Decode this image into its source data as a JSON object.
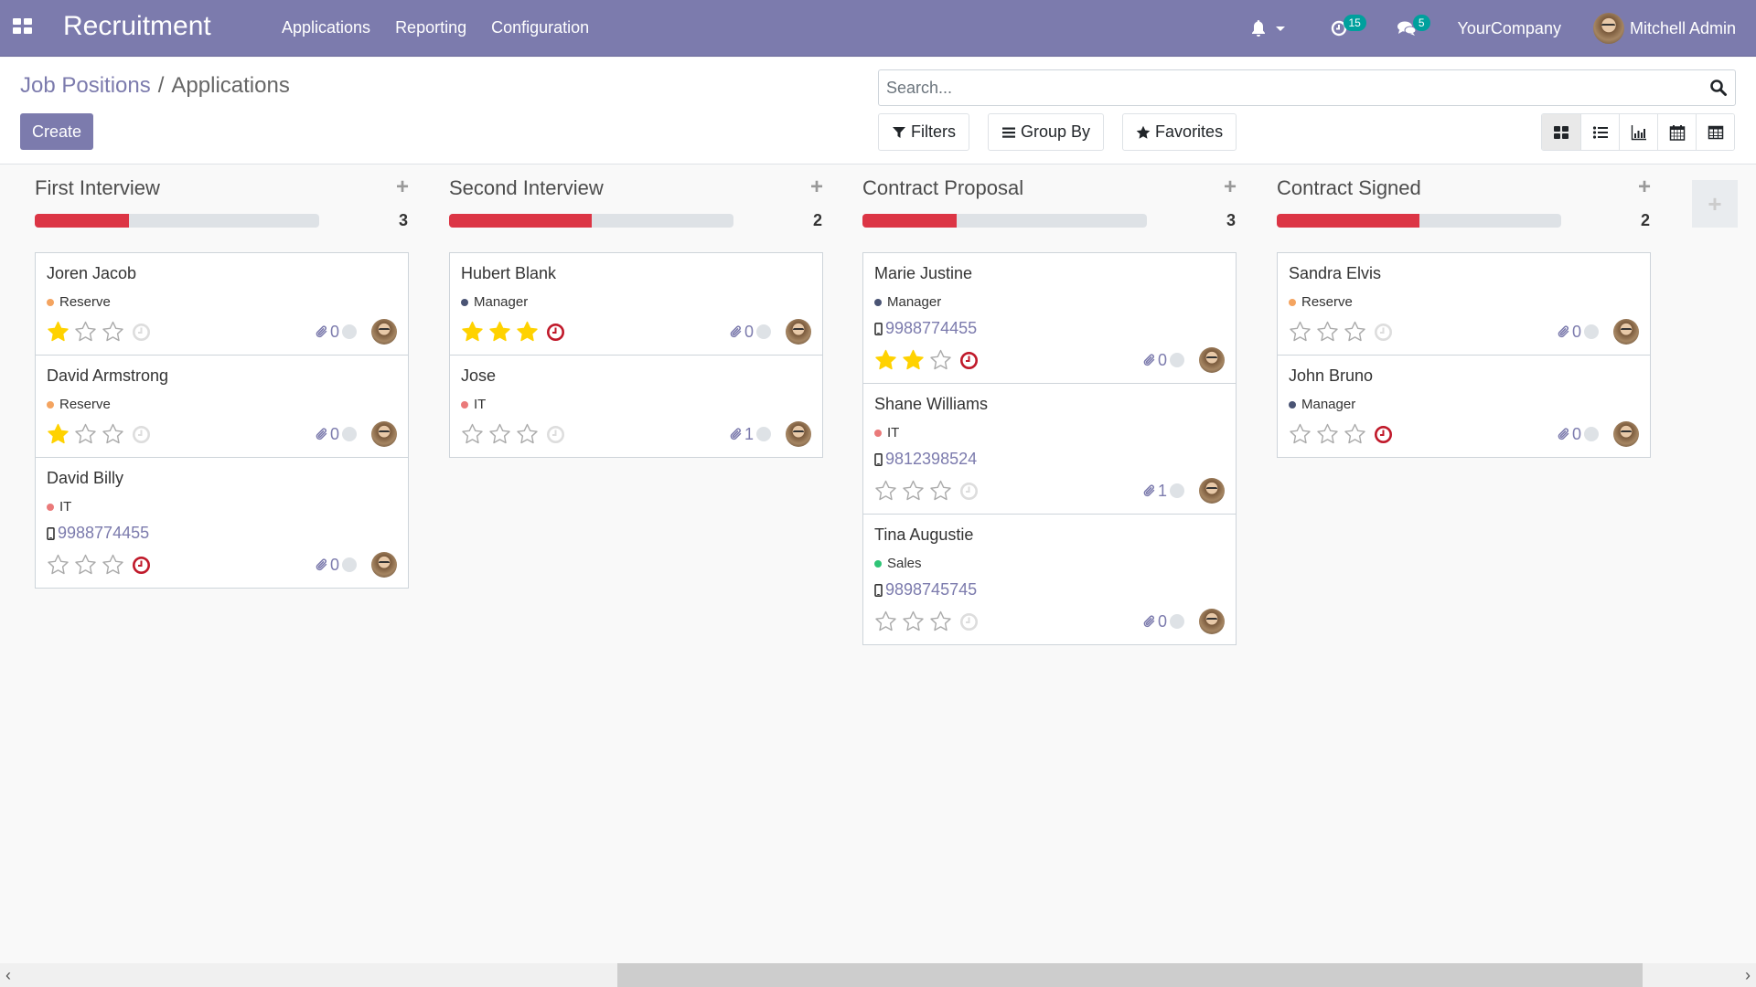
{
  "navbar": {
    "app_title": "Recruitment",
    "menu": [
      "Applications",
      "Reporting",
      "Configuration"
    ],
    "activity_count": "15",
    "message_count": "5",
    "company": "YourCompany",
    "user": "Mitchell Admin"
  },
  "control": {
    "breadcrumb": {
      "parent": "Job Positions",
      "separator": "/",
      "current": "Applications"
    },
    "create_label": "Create",
    "search_placeholder": "Search...",
    "filters_label": "Filters",
    "groupby_label": "Group By",
    "favorites_label": "Favorites",
    "views": [
      "kanban",
      "list",
      "graph",
      "calendar",
      "pivot"
    ],
    "active_view": "kanban"
  },
  "colors": {
    "brand": "#7c7bad",
    "progress_red": "#dc3545",
    "star_gold": "#ffd200",
    "clock_red": "#c0192a",
    "badge_teal": "#00a09d"
  },
  "tag_colors": {
    "Reserve": "#f4a460",
    "IT": "#ea7a7a",
    "Manager": "#4a5474",
    "Sales": "#2fc476"
  },
  "columns": [
    {
      "title": "First Interview",
      "count": "3",
      "progress_red_fraction": 0.33,
      "cards": [
        {
          "name": "Joren Jacob",
          "tag": "Reserve",
          "phone": null,
          "stars": 1,
          "activity_overdue": false,
          "attachments": "0"
        },
        {
          "name": "David Armstrong",
          "tag": "Reserve",
          "phone": null,
          "stars": 1,
          "activity_overdue": false,
          "attachments": "0"
        },
        {
          "name": "David Billy",
          "tag": "IT",
          "phone": "9988774455",
          "stars": 0,
          "activity_overdue": true,
          "attachments": "0"
        }
      ]
    },
    {
      "title": "Second Interview",
      "count": "2",
      "progress_red_fraction": 0.5,
      "cards": [
        {
          "name": "Hubert Blank",
          "tag": "Manager",
          "phone": null,
          "stars": 3,
          "activity_overdue": true,
          "attachments": "0"
        },
        {
          "name": "Jose",
          "tag": "IT",
          "phone": null,
          "stars": 0,
          "activity_overdue": false,
          "attachments": "1"
        }
      ]
    },
    {
      "title": "Contract Proposal",
      "count": "3",
      "progress_red_fraction": 0.33,
      "cards": [
        {
          "name": "Marie Justine",
          "tag": "Manager",
          "phone": "9988774455",
          "stars": 2,
          "activity_overdue": true,
          "attachments": "0"
        },
        {
          "name": "Shane Williams",
          "tag": "IT",
          "phone": "9812398524",
          "stars": 0,
          "activity_overdue": false,
          "attachments": "1"
        },
        {
          "name": "Tina Augustie",
          "tag": "Sales",
          "phone": "9898745745",
          "stars": 0,
          "activity_overdue": false,
          "attachments": "0"
        }
      ]
    },
    {
      "title": "Contract Signed",
      "count": "2",
      "progress_red_fraction": 0.5,
      "cards": [
        {
          "name": "Sandra Elvis",
          "tag": "Reserve",
          "phone": null,
          "stars": 0,
          "activity_overdue": false,
          "attachments": "0"
        },
        {
          "name": "John Bruno",
          "tag": "Manager",
          "phone": null,
          "stars": 0,
          "activity_overdue": true,
          "attachments": "0"
        }
      ]
    }
  ],
  "add_column_label": "+",
  "column_add_label": "+"
}
